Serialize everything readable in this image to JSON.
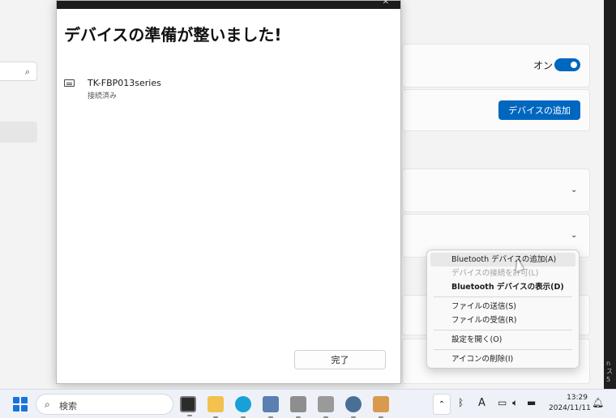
{
  "background": {
    "toggle_label": "オン",
    "add_device_button": "デバイスの追加",
    "right_edge_lines": [
      "n",
      "ス",
      "5"
    ]
  },
  "dialog": {
    "heading": "デバイスの準備が整いました!",
    "device_name": "TK-FBP013series",
    "device_status": "接続済み",
    "finish_button": "完了"
  },
  "context_menu": {
    "items": [
      {
        "label": "Bluetooth デバイスの追加(A)",
        "state": "hover"
      },
      {
        "label": "デバイスの接続を許可(L)",
        "state": "disabled"
      },
      {
        "label": "Bluetooth デバイスの表示(D)",
        "state": "bold"
      },
      {
        "label": "ファイルの送信(S)",
        "state": "normal"
      },
      {
        "label": "ファイルの受信(R)",
        "state": "normal"
      },
      {
        "label": "設定を開く(O)",
        "state": "normal"
      },
      {
        "label": "アイコンの削除(I)",
        "state": "normal"
      }
    ]
  },
  "taskbar": {
    "search_placeholder": "検索",
    "ime_indicator": "A",
    "time": "13:29",
    "date": "2024/11/11"
  },
  "colors": {
    "accent": "#0067c0",
    "taskbar": "#eef2f8"
  }
}
